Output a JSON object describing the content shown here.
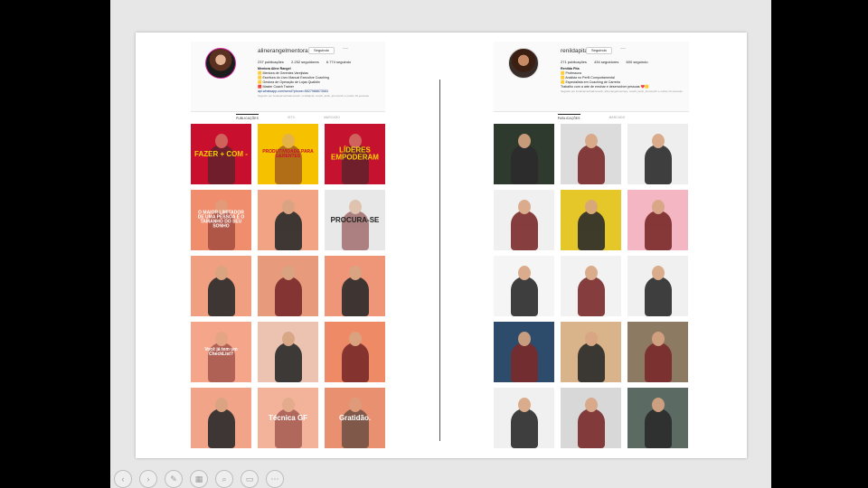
{
  "profiles": [
    {
      "username": "alinerangelmentora",
      "follow_label": "Seguindo",
      "more_label": "···",
      "stats": [
        "237 publicações",
        "2.252 seguidores",
        "6.774 seguindo"
      ],
      "bio_name": "Mentora Aline Rangel",
      "bio_lines": [
        "🟨 Mentora de Gerentes Varejistas",
        "🟨 Escritora do Livro Manual Executive Coaching",
        "🟨 Gestora de Operação de Lojas Qualidin",
        "🟥 Master Coach Trainer"
      ],
      "bio_link": "api.whatsapp.com/send?phone=5527988673583",
      "bio_followed": "Seguido por lucianamachadocoach, renildapita, coach_karin_krumreich e outras 15 pessoas",
      "tabs": [
        "PUBLICAÇÕES",
        "IGTV",
        "MARCADO"
      ],
      "tiles": [
        {
          "caption": "FAZER + COM -",
          "bg": "#c8102e",
          "fg": "#f6d000"
        },
        {
          "caption": "PRODUTIVIDADE PARA GERENTES",
          "bg": "#f6c200",
          "fg": "#c8102e"
        },
        {
          "caption": "LÍDERES EMPODERAM",
          "bg": "#c4122f",
          "fg": "#f6d000"
        },
        {
          "caption": "O MAIOR LIMITADOR DE UMA PESSOA É O TAMANHO DO SEU SONHO",
          "bg": "#ef8d6c",
          "fg": "#ffffff"
        },
        {
          "caption": "",
          "bg": "#f1a383",
          "fg": "#ffffff"
        },
        {
          "caption": "PROCURA-SE",
          "bg": "#e8e8e8",
          "fg": "#222222"
        },
        {
          "caption": "",
          "bg": "#f0a080",
          "fg": "#ffffff"
        },
        {
          "caption": "",
          "bg": "#e89a7c",
          "fg": "#ffffff"
        },
        {
          "caption": "",
          "bg": "#ef9578",
          "fg": "#ffffff"
        },
        {
          "caption": "Você já tem um CheckList?",
          "bg": "#f4a58a",
          "fg": "#ffffff"
        },
        {
          "caption": "",
          "bg": "#ecc3b0",
          "fg": "#ffffff"
        },
        {
          "caption": "",
          "bg": "#ef8a66",
          "fg": "#ffffff"
        },
        {
          "caption": "",
          "bg": "#f1a488",
          "fg": "#ffffff"
        },
        {
          "caption": "Técnica GF",
          "bg": "#f3b39a",
          "fg": "#ffffff"
        },
        {
          "caption": "Gratidão.",
          "bg": "#e89070",
          "fg": "#ffffff"
        }
      ]
    },
    {
      "username": "renildapita",
      "follow_label": "Seguindo",
      "more_label": "···",
      "stats": [
        "271 publicações",
        "434 seguidores",
        "600 seguindo"
      ],
      "bio_name": "Renilda Pita",
      "bio_lines": [
        "🟨 Professora",
        "🟨 Analista no Perfil Comportamental",
        "🟨 Especialista em Coaching de Carreira",
        "Trabalho com a arte de ensinar e desenvolver pessoas ❤️🟨"
      ],
      "bio_link": "",
      "bio_followed": "Seguido por lucianamachadocoach, alinerangelmentora, coach_karin_krumreich e outras 12 pessoas",
      "tabs": [
        "PUBLICAÇÕES",
        "MARCADO"
      ],
      "tiles": [
        {
          "caption": "",
          "bg": "#2f3a2f",
          "fg": "#ffffff"
        },
        {
          "caption": "",
          "bg": "#dcdcdc",
          "fg": "#ffffff"
        },
        {
          "caption": "",
          "bg": "#eeeeee",
          "fg": "#333333"
        },
        {
          "caption": "",
          "bg": "#f0f0f0",
          "fg": "#333333"
        },
        {
          "caption": "",
          "bg": "#e6c72a",
          "fg": "#222222"
        },
        {
          "caption": "",
          "bg": "#f3b6c2",
          "fg": "#ffffff"
        },
        {
          "caption": "",
          "bg": "#f5f5f5",
          "fg": "#333333"
        },
        {
          "caption": "",
          "bg": "#f2f2f2",
          "fg": "#333333"
        },
        {
          "caption": "",
          "bg": "#f0f0f0",
          "fg": "#333333"
        },
        {
          "caption": "",
          "bg": "#2d4b6b",
          "fg": "#ffffff"
        },
        {
          "caption": "",
          "bg": "#d9b38a",
          "fg": "#ffffff"
        },
        {
          "caption": "",
          "bg": "#8d7a62",
          "fg": "#ffffff"
        },
        {
          "caption": "",
          "bg": "#f0f0f0",
          "fg": "#333333"
        },
        {
          "caption": "",
          "bg": "#d8d8d8",
          "fg": "#333333"
        },
        {
          "caption": "",
          "bg": "#5c6a64",
          "fg": "#ffffff"
        }
      ]
    }
  ],
  "controls": [
    "prev-icon",
    "next-icon",
    "pen-icon",
    "gallery-icon",
    "zoom-icon",
    "subtitles-icon",
    "more-icon"
  ]
}
